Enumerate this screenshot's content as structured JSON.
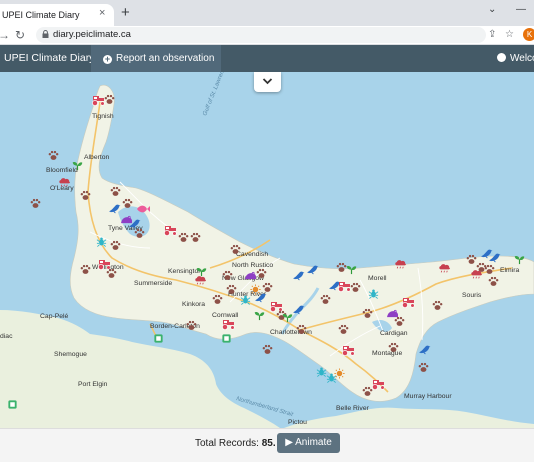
{
  "browser": {
    "tab_title": "UPEI Climate Diary",
    "tab_close_glyph": "×",
    "new_tab_glyph": "+",
    "url": "diary.peiclimate.ca",
    "profile_initial": "K"
  },
  "navbar": {
    "brand": "UPEI Climate Diary",
    "report_label": "Report an observation",
    "welcome_label": "Welco"
  },
  "map": {
    "labels": {
      "tignish": "Tignish",
      "alberton": "Alberton",
      "bloomfield": "Bloomfield",
      "oleary": "O'Leary",
      "tyne_valley": "Tyne Valley",
      "wellington": "Wellington",
      "summerside": "Summerside",
      "kensington": "Kensington",
      "cavendish": "Cavendish",
      "north_rustico": "North Rustico",
      "new_glasgow": "New Glasgow",
      "hunter_river": "Hunter River",
      "kinkora": "Kinkora",
      "borden_carleton": "Borden-Carleton",
      "cornwall": "Cornwall",
      "charlottetown": "Charlottetown",
      "morell": "Morell",
      "elmira": "Elmira",
      "souris": "Souris",
      "cardigan": "Cardigan",
      "montague": "Montague",
      "murray_harbour": "Murray\nHarbour",
      "belle_river": "Belle River",
      "cap_pele": "Cap-Pelé",
      "shemogue": "Shemogue",
      "port_elgin": "Port Elgin",
      "gulf": "Gulf of St. Lawrence",
      "strait": "Northumberland Strait",
      "diac": "diac",
      "pictou": "Pictou"
    }
  },
  "footer": {
    "total_label": "Total Records:",
    "total_value": "85.",
    "animate_label": "Animate",
    "play_glyph": "▶"
  }
}
